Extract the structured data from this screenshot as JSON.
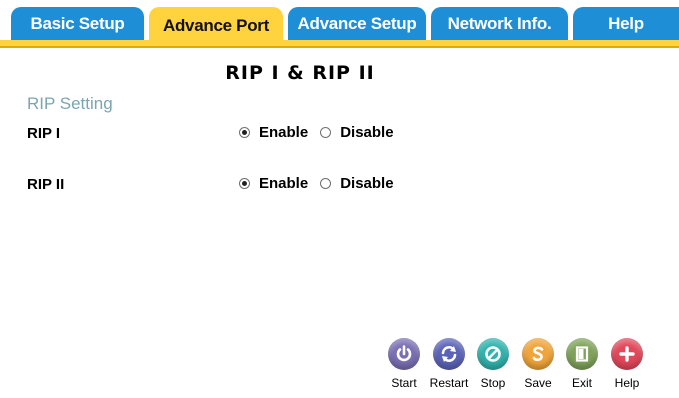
{
  "nav": {
    "tabs": [
      {
        "label": "Basic Setup"
      },
      {
        "label": "Advance Port"
      },
      {
        "label": "Advance Setup"
      },
      {
        "label": "Network Info."
      },
      {
        "label": "Help"
      }
    ]
  },
  "main": {
    "title": "RIP I & RIP II",
    "section_title": "RIP Setting",
    "rows": [
      {
        "label": "RIP I",
        "enable_label": "Enable",
        "disable_label": "Disable",
        "selected": "Enable"
      },
      {
        "label": "RIP II",
        "enable_label": "Enable",
        "disable_label": "Disable",
        "selected": "Enable"
      }
    ]
  },
  "actions": [
    {
      "label": "Start",
      "icon": "power-icon",
      "color": "#7a6fb3"
    },
    {
      "label": "Restart",
      "icon": "restart-icon",
      "color": "#5b63b8"
    },
    {
      "label": "Stop",
      "icon": "stop-icon",
      "color": "#2fb3ad"
    },
    {
      "label": "Save",
      "icon": "save-icon",
      "color": "#f0a43a"
    },
    {
      "label": "Exit",
      "icon": "exit-icon",
      "color": "#7fa35a"
    },
    {
      "label": "Help",
      "icon": "plus-icon",
      "color": "#e2475a"
    }
  ],
  "colors": {
    "tab_blue": "#1e8fd6",
    "tab_active": "#ffd33d",
    "section_title": "#7aa6b0"
  }
}
